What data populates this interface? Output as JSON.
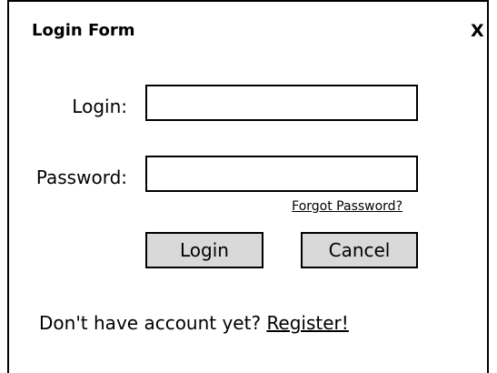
{
  "window": {
    "title": "Login Form",
    "close_label": "X"
  },
  "form": {
    "login_label": "Login:",
    "login_value": "",
    "password_label": "Password:",
    "password_value": "",
    "forgot_password": "Forgot Password?"
  },
  "buttons": {
    "login": "Login",
    "cancel": "Cancel"
  },
  "footer": {
    "prompt": "Don't have account yet? ",
    "register": "Register!"
  }
}
